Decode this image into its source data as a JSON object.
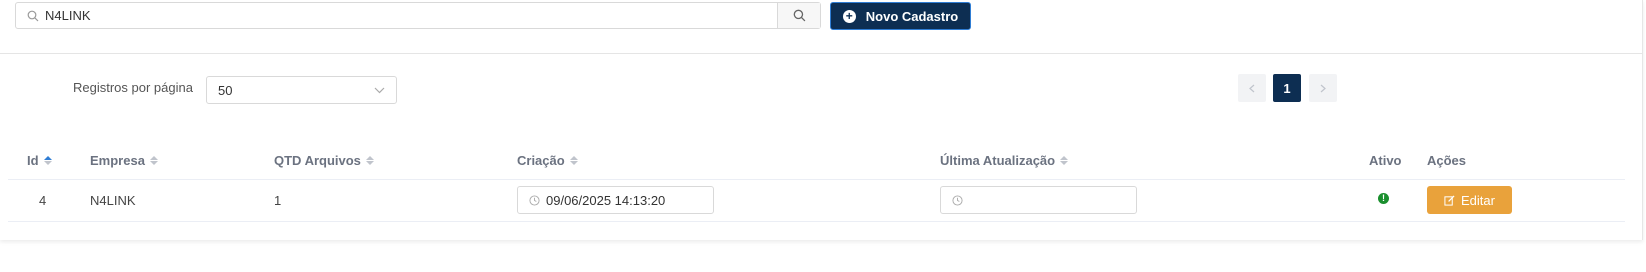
{
  "search": {
    "value": "N4LINK"
  },
  "toolbar": {
    "new_label": "Novo Cadastro"
  },
  "pagination": {
    "per_page_label": "Registros por página",
    "per_page_value": "50",
    "current_page": "1"
  },
  "table": {
    "headers": {
      "id": "Id",
      "empresa": "Empresa",
      "qtd": "QTD Arquivos",
      "criacao": "Criação",
      "atualizacao": "Última Atualização",
      "ativo": "Ativo",
      "acoes": "Ações"
    },
    "rows": [
      {
        "id": "4",
        "empresa": "N4LINK",
        "qtd": "1",
        "criacao": "09/06/2025 14:13:20",
        "atualizacao": "",
        "ativo": "!",
        "edit_label": "Editar"
      }
    ]
  },
  "colors": {
    "primary": "#0d2e52",
    "edit": "#e9a23b",
    "active": "#1a8f2e"
  }
}
